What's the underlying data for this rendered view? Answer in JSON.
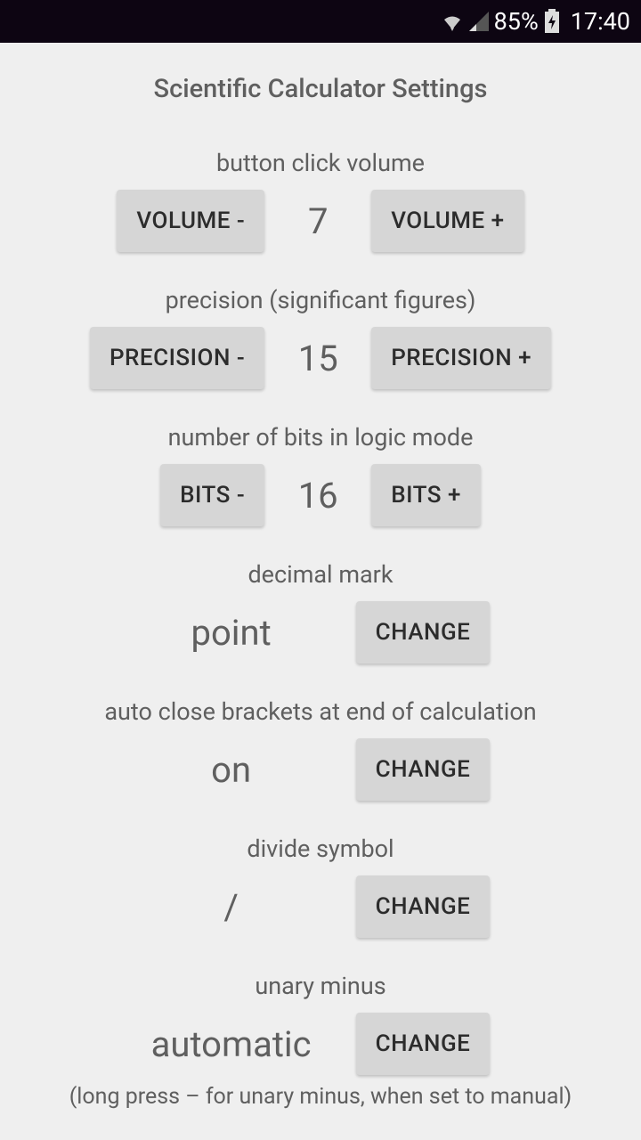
{
  "statusbar": {
    "battery_pct": "85%",
    "clock": "17:40"
  },
  "page_title": "Scientific Calculator Settings",
  "settings": {
    "volume": {
      "label": "button click volume",
      "minus": "VOLUME -",
      "plus": "VOLUME +",
      "value": "7"
    },
    "precision": {
      "label": "precision (significant figures)",
      "minus": "PRECISION -",
      "plus": "PRECISION +",
      "value": "15"
    },
    "bits": {
      "label": "number of bits in logic mode",
      "minus": "BITS -",
      "plus": "BITS +",
      "value": "16"
    },
    "decimal_mark": {
      "label": "decimal mark",
      "value": "point",
      "change": "CHANGE"
    },
    "auto_close": {
      "label": "auto close brackets at end of calculation",
      "value": "on",
      "change": "CHANGE"
    },
    "divide_symbol": {
      "label": "divide symbol",
      "value": "/",
      "change": "CHANGE"
    },
    "unary_minus": {
      "label": "unary minus",
      "value": "automatic",
      "change": "CHANGE",
      "hint": "(long press – for unary minus, when set to manual)"
    }
  }
}
